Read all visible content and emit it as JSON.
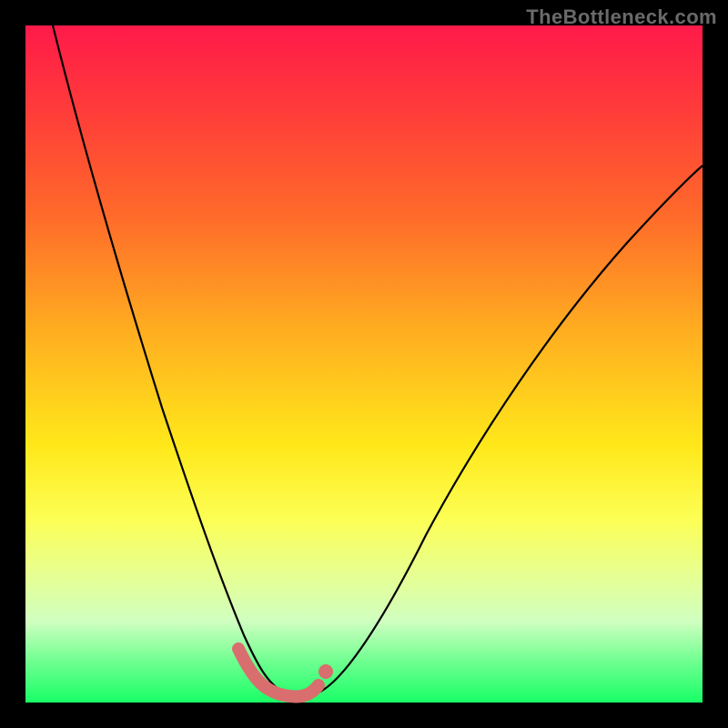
{
  "watermark": {
    "text": "TheBottleneck.com"
  },
  "chart_data": {
    "type": "line",
    "title": "",
    "xlabel": "",
    "ylabel": "",
    "xlim": [
      0,
      100
    ],
    "ylim": [
      0,
      100
    ],
    "grid": false,
    "series": [
      {
        "name": "bottleneck-curve",
        "x": [
          4,
          8,
          12,
          16,
          20,
          24,
          28,
          30,
          32,
          34,
          36,
          38,
          40,
          42,
          44,
          48,
          52,
          58,
          64,
          72,
          80,
          88,
          96,
          100
        ],
        "y": [
          100,
          84,
          70,
          57,
          45,
          33,
          22,
          16,
          11,
          7,
          4,
          2,
          2,
          3,
          5,
          10,
          16,
          26,
          35,
          47,
          57,
          66,
          74,
          78
        ]
      }
    ],
    "highlight": {
      "name": "optimal-range",
      "x_range": [
        31,
        43
      ],
      "marker_x": 43,
      "marker_y": 6
    },
    "background_gradient": {
      "top": "#ff1a4a",
      "mid": "#ffe81a",
      "bottom": "#18ff66"
    }
  }
}
